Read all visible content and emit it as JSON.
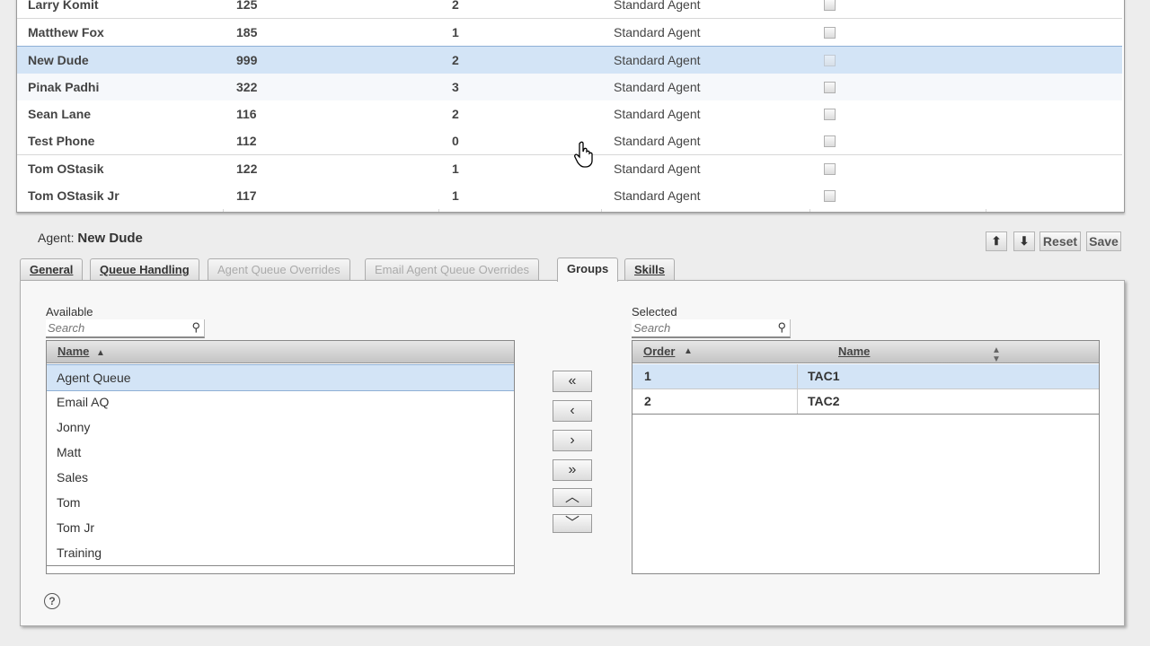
{
  "agents_table": {
    "rows": [
      {
        "name": "Larry Komit",
        "ext": "125",
        "count": "2",
        "type": "Standard Agent"
      },
      {
        "name": "Matthew Fox",
        "ext": "185",
        "count": "1",
        "type": "Standard Agent"
      },
      {
        "name": "New Dude",
        "ext": "999",
        "count": "2",
        "type": "Standard Agent"
      },
      {
        "name": "Pinak Padhi",
        "ext": "322",
        "count": "3",
        "type": "Standard Agent"
      },
      {
        "name": "Sean Lane",
        "ext": "116",
        "count": "2",
        "type": "Standard Agent"
      },
      {
        "name": "Test Phone",
        "ext": "112",
        "count": "0",
        "type": "Standard Agent"
      },
      {
        "name": "Tom OStasik",
        "ext": "122",
        "count": "1",
        "type": "Standard Agent"
      },
      {
        "name": "Tom OStasik Jr",
        "ext": "117",
        "count": "1",
        "type": "Standard Agent"
      }
    ],
    "selected_row": "New Dude"
  },
  "agent_header": {
    "label": "Agent:",
    "name": "New Dude"
  },
  "toolbar": {
    "up_icon": "arrow-up-icon",
    "down_icon": "arrow-down-icon",
    "reset_label": "Reset",
    "save_label": "Save"
  },
  "tabs": [
    {
      "label": "General",
      "state": "normal"
    },
    {
      "label": "Queue Handling",
      "state": "normal"
    },
    {
      "label": "Agent Queue Overrides",
      "state": "disabled"
    },
    {
      "label": "Email Agent Queue Overrides",
      "state": "disabled"
    },
    {
      "label": "Groups",
      "state": "active"
    },
    {
      "label": "Skills",
      "state": "normal"
    }
  ],
  "available": {
    "label": "Available",
    "search_placeholder": "Search",
    "column_header": "Name",
    "items": [
      "Agent Queue",
      "Email AQ",
      "Jonny",
      "Matt",
      "Sales",
      "Tom",
      "Tom Jr",
      "Training"
    ],
    "selected_item": "Agent Queue"
  },
  "selected": {
    "label": "Selected",
    "search_placeholder": "Search",
    "columns": [
      "Order",
      "Name"
    ],
    "rows": [
      {
        "order": "1",
        "name": "TAC1"
      },
      {
        "order": "2",
        "name": "TAC2"
      }
    ]
  },
  "move_buttons": [
    "move-all-left-icon",
    "move-left-icon",
    "move-right-icon",
    "move-all-right-icon",
    "move-up-icon",
    "move-down-icon"
  ],
  "colors": {
    "selection": "#d3e4f6",
    "panel": "#f7f7f7",
    "background": "#ededed"
  }
}
